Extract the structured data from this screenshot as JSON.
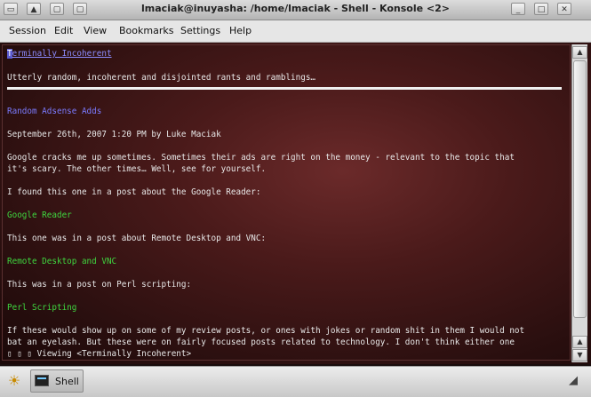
{
  "window": {
    "title": "lmaciak@inuyasha: /home/lmaciak - Shell - Konsole <2>"
  },
  "menu": [
    "Session",
    "Edit",
    "View",
    "Bookmarks",
    "Settings",
    "Help"
  ],
  "terminal": {
    "site_title": "Terminally Incoherent",
    "tagline": "Utterly random, incoherent and disjointed rants and ramblings…",
    "post_title": "Random Adsense Adds",
    "post_meta": "September 26th, 2007 1:20 PM by Luke Maciak",
    "para1_line1": "Google cracks me up sometimes. Sometimes their ads are right on the money - relevant to the topic that",
    "para1_line2": "it's scary. The other times… Well, see for yourself.",
    "para2": "I found this one in a post about the Google Reader:",
    "link1": "Google Reader",
    "para3": "This one was in a post about Remote Desktop and VNC:",
    "link2": "Remote Desktop and VNC",
    "para4": "This was in a post on Perl scripting:",
    "link3": "Perl Scripting",
    "para5_line1": "If these would show up on some of my review posts, or ones with jokes or random shit in them I would not",
    "para5_line2": "bat an eyelash. But these were on fairly focused posts related to technology. I don't think either one",
    "status": "▯ ▯ ▯ Viewing <Terminally Incoherent>"
  },
  "taskbar": {
    "task_label": "Shell"
  },
  "colors": {
    "link_blue": "#7b7bff",
    "link_green": "#3fd63f",
    "text": "#e8e8e8"
  }
}
